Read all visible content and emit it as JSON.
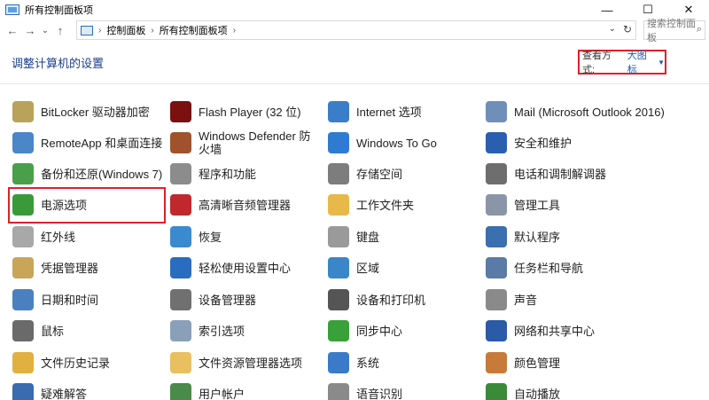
{
  "window": {
    "title": "所有控制面板项",
    "minimize": "—",
    "maximize": "☐",
    "close": "✕"
  },
  "nav": {
    "back": "←",
    "forward": "→",
    "history": "⌄",
    "up": "↑",
    "breadcrumbs": [
      "控制面板",
      "所有控制面板项"
    ],
    "separator": "›",
    "dropdown": "⌄",
    "refresh": "↻",
    "search_placeholder": "搜索控制面板",
    "search_icon": "⌕"
  },
  "header": {
    "title": "调整计算机的设置",
    "view_by_label": "查看方式:",
    "view_by_value": "大图标",
    "view_by_arrow": "▼"
  },
  "highlight_color": "#e0202a",
  "items": [
    {
      "label": "BitLocker 驱动器加密",
      "icon": "bitlocker-key-icon",
      "color": "#b9a35a"
    },
    {
      "label": "Flash Player (32 位)",
      "icon": "flash-player-icon",
      "color": "#7a1010"
    },
    {
      "label": "Internet 选项",
      "icon": "internet-options-icon",
      "color": "#3a7dc9"
    },
    {
      "label": "Mail (Microsoft Outlook 2016)",
      "icon": "mail-outlook-icon",
      "color": "#6f8fb8"
    },
    {
      "label": "RemoteApp 和桌面连接",
      "icon": "remoteapp-icon",
      "color": "#4a86c8"
    },
    {
      "label": "Windows Defender 防火墙",
      "icon": "firewall-icon",
      "color": "#a0522d"
    },
    {
      "label": "Windows To Go",
      "icon": "windows-to-go-icon",
      "color": "#2f7bd1"
    },
    {
      "label": "安全和维护",
      "icon": "security-flag-icon",
      "color": "#2a5fb0"
    },
    {
      "label": "备份和还原(Windows 7)",
      "icon": "backup-restore-icon",
      "color": "#4aa04a"
    },
    {
      "label": "程序和功能",
      "icon": "programs-features-icon",
      "color": "#8c8c8c"
    },
    {
      "label": "存储空间",
      "icon": "storage-spaces-icon",
      "color": "#7d7d7d"
    },
    {
      "label": "电话和调制解调器",
      "icon": "phone-modem-icon",
      "color": "#6e6e6e"
    },
    {
      "label": "电源选项",
      "icon": "power-options-icon",
      "color": "#3a9a3a"
    },
    {
      "label": "高清晰音频管理器",
      "icon": "audio-manager-icon",
      "color": "#c0282d"
    },
    {
      "label": "工作文件夹",
      "icon": "work-folders-icon",
      "color": "#e7b84a"
    },
    {
      "label": "管理工具",
      "icon": "admin-tools-icon",
      "color": "#8a96a8"
    },
    {
      "label": "红外线",
      "icon": "infrared-icon",
      "color": "#a8a8a8"
    },
    {
      "label": "恢复",
      "icon": "recovery-icon",
      "color": "#3a8ad0"
    },
    {
      "label": "键盘",
      "icon": "keyboard-icon",
      "color": "#9a9a9a"
    },
    {
      "label": "默认程序",
      "icon": "default-programs-icon",
      "color": "#3a6fb0"
    },
    {
      "label": "凭据管理器",
      "icon": "credential-manager-icon",
      "color": "#c9a55a"
    },
    {
      "label": "轻松使用设置中心",
      "icon": "ease-of-access-icon",
      "color": "#2a6cc0"
    },
    {
      "label": "区域",
      "icon": "region-globe-icon",
      "color": "#3a86c8"
    },
    {
      "label": "任务栏和导航",
      "icon": "taskbar-navigation-icon",
      "color": "#5a7aa8"
    },
    {
      "label": "日期和时间",
      "icon": "date-time-icon",
      "color": "#4a80c0"
    },
    {
      "label": "设备管理器",
      "icon": "device-manager-icon",
      "color": "#707070"
    },
    {
      "label": "设备和打印机",
      "icon": "devices-printers-icon",
      "color": "#555555"
    },
    {
      "label": "声音",
      "icon": "sound-speaker-icon",
      "color": "#8a8a8a"
    },
    {
      "label": "鼠标",
      "icon": "mouse-icon",
      "color": "#6a6a6a"
    },
    {
      "label": "索引选项",
      "icon": "indexing-options-icon",
      "color": "#8aa0b8"
    },
    {
      "label": "同步中心",
      "icon": "sync-center-icon",
      "color": "#3aa03a"
    },
    {
      "label": "网络和共享中心",
      "icon": "network-sharing-icon",
      "color": "#2a5aa8"
    },
    {
      "label": "文件历史记录",
      "icon": "file-history-icon",
      "color": "#e0b040"
    },
    {
      "label": "文件资源管理器选项",
      "icon": "explorer-options-icon",
      "color": "#e8c060"
    },
    {
      "label": "系统",
      "icon": "system-icon",
      "color": "#3a7ac8"
    },
    {
      "label": "颜色管理",
      "icon": "color-management-icon",
      "color": "#c87a3a"
    },
    {
      "label": "疑难解答",
      "icon": "troubleshooting-icon",
      "color": "#3a6ab0"
    },
    {
      "label": "用户帐户",
      "icon": "user-accounts-icon",
      "color": "#4a8a4a"
    },
    {
      "label": "语音识别",
      "icon": "speech-recognition-icon",
      "color": "#8a8a8a"
    },
    {
      "label": "自动播放",
      "icon": "autoplay-icon",
      "color": "#3a8a3a"
    }
  ]
}
